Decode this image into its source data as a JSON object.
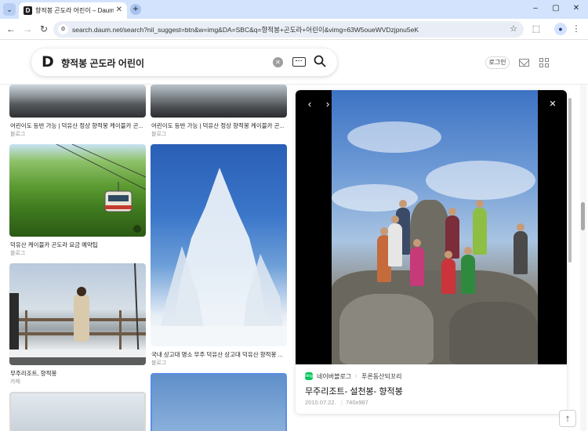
{
  "browser": {
    "tab_title": "향적봉 곤도라 어린이 – Daum 검색",
    "url": "search.daum.net/search?nil_suggest=btn&w=img&DA=SBC&q=향적봉+곤도라+어린이&vimg=63W5oueWVDzjpnu5eK",
    "tab_close": "✕",
    "new_tab": "+",
    "tab_list": "⌄",
    "back": "←",
    "forward": "→",
    "reload": "↻",
    "star": "☆",
    "minimize": "–",
    "maximize": "▢",
    "close": "✕"
  },
  "header": {
    "logo": "D",
    "query": "향적봉 곤도라 어린이",
    "clear": "✕",
    "search": "⌕",
    "login_label": "로그인"
  },
  "results": [
    {
      "title": "어린이도 등반 가능 | 덕유산 정상 향적봉 케이블카 곤...",
      "source": "블로그"
    },
    {
      "title": "어린이도 등반 가능 | 덕유산 정상 향적봉 케이블카 곤...",
      "source": "블로그"
    },
    {
      "title": "덕유산 케이블카 곤도라 요금 예약팁",
      "source": "블로그"
    },
    {
      "title": "국내 상고대 명소 무주 덕유산 상고대 덕유산 향적봉 ...",
      "source": "블로그"
    },
    {
      "title": "무주리조트, 향적봉",
      "source": "카페"
    }
  ],
  "viewer": {
    "prev": "‹",
    "next": "›",
    "close": "✕",
    "source_badge": "blog",
    "source_name": "네이버블로그",
    "source_separator": "›",
    "source_sub": "푸른동산되꼬리",
    "title": "무주리조트- 설천봉- 향적봉",
    "date": "2010.07.22.",
    "meta_separator": "|",
    "size": "740x987"
  },
  "top_button": "↑",
  "colors": {
    "tabbar": "#d3e3fd",
    "naver_green": "#03c75a"
  }
}
